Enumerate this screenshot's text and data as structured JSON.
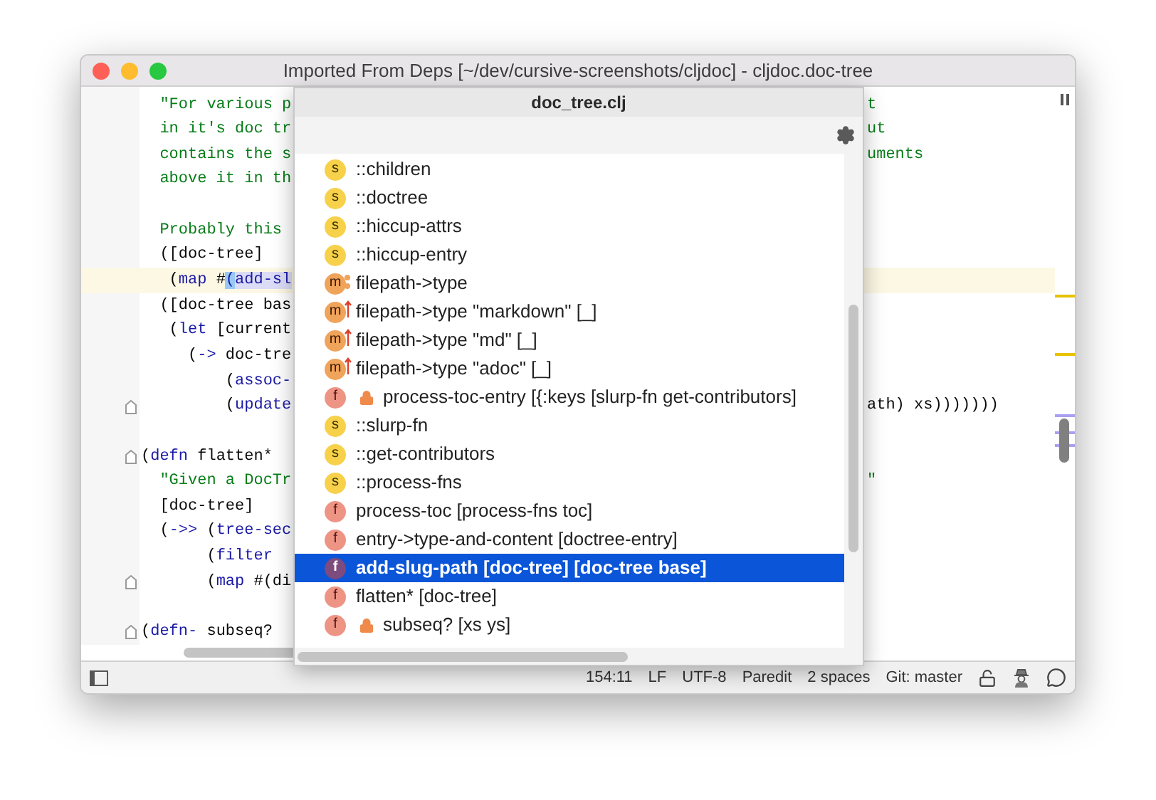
{
  "window": {
    "title": "Imported From Deps [~/dev/cursive-screenshots/cljdoc] - cljdoc.doc-tree"
  },
  "editor": {
    "lines": [
      {
        "segments": [
          {
            "text": "  \"For various p",
            "kind": "string"
          }
        ],
        "right": {
          "text": "t",
          "kind": "string"
        },
        "current": false,
        "fold": false
      },
      {
        "segments": [
          {
            "text": "  in it's doc tr",
            "kind": "string"
          }
        ],
        "right": {
          "text": "ut",
          "kind": "string"
        },
        "current": false,
        "fold": false
      },
      {
        "segments": [
          {
            "text": "  contains the s",
            "kind": "string"
          }
        ],
        "right": {
          "text": "uments",
          "kind": "string"
        },
        "current": false,
        "fold": false
      },
      {
        "segments": [
          {
            "text": "  above it in th",
            "kind": "string"
          }
        ],
        "current": false,
        "fold": false
      },
      {
        "current": false,
        "fold": false
      },
      {
        "segments": [
          {
            "text": "  Probably this",
            "kind": "string"
          }
        ],
        "current": false,
        "fold": false
      },
      {
        "segments": [
          {
            "text": "  ([doc-tree]",
            "kind": "plain"
          }
        ],
        "current": false,
        "fold": false
      },
      {
        "segments": [
          {
            "text": "   (",
            "kind": "plain"
          },
          {
            "text": "map",
            "kind": "keyword"
          },
          {
            "text": " #",
            "kind": "plain"
          },
          {
            "text": "(",
            "kind": "match"
          },
          {
            "text": "add-sl",
            "kind": "usage"
          }
        ],
        "current": true,
        "fold": false
      },
      {
        "segments": [
          {
            "text": "  ([doc-tree bas",
            "kind": "plain"
          }
        ],
        "current": false,
        "fold": false
      },
      {
        "segments": [
          {
            "text": "   (",
            "kind": "plain"
          },
          {
            "text": "let",
            "kind": "keyword"
          },
          {
            "text": " [current",
            "kind": "plain"
          }
        ],
        "current": false,
        "fold": false
      },
      {
        "segments": [
          {
            "text": "     (",
            "kind": "plain"
          },
          {
            "text": "->",
            "kind": "keyword"
          },
          {
            "text": " doc-tre",
            "kind": "plain"
          }
        ],
        "current": false,
        "fold": false
      },
      {
        "segments": [
          {
            "text": "         (",
            "kind": "plain"
          },
          {
            "text": "assoc-",
            "kind": "keyword"
          }
        ],
        "current": false,
        "fold": false
      },
      {
        "segments": [
          {
            "text": "         (",
            "kind": "plain"
          },
          {
            "text": "update",
            "kind": "keyword"
          }
        ],
        "right": {
          "text": "ath) xs)))))))",
          "kind": "plain"
        },
        "current": false,
        "fold": true
      },
      {
        "current": false,
        "fold": false
      },
      {
        "segments": [
          {
            "text": "(",
            "kind": "plain"
          },
          {
            "text": "defn",
            "kind": "keyword"
          },
          {
            "text": " flatten*",
            "kind": "plain"
          }
        ],
        "current": false,
        "fold": true
      },
      {
        "segments": [
          {
            "text": "  \"Given a DocTr",
            "kind": "string"
          }
        ],
        "right": {
          "text": "\"",
          "kind": "string"
        },
        "current": false,
        "fold": false
      },
      {
        "segments": [
          {
            "text": "  [doc-tree]",
            "kind": "plain"
          }
        ],
        "current": false,
        "fold": false
      },
      {
        "segments": [
          {
            "text": "  (",
            "kind": "plain"
          },
          {
            "text": "->>",
            "kind": "keyword"
          },
          {
            "text": " (",
            "kind": "plain"
          },
          {
            "text": "tree-sec",
            "kind": "keyword"
          }
        ],
        "current": false,
        "fold": false
      },
      {
        "segments": [
          {
            "text": "       (",
            "kind": "plain"
          },
          {
            "text": "filter",
            "kind": "keyword"
          }
        ],
        "current": false,
        "fold": false
      },
      {
        "segments": [
          {
            "text": "       (",
            "kind": "plain"
          },
          {
            "text": "map",
            "kind": "keyword"
          },
          {
            "text": " #(di",
            "kind": "plain"
          }
        ],
        "current": false,
        "fold": true
      },
      {
        "current": false,
        "fold": false
      },
      {
        "segments": [
          {
            "text": "(",
            "kind": "plain"
          },
          {
            "text": "defn-",
            "kind": "keyword"
          },
          {
            "text": " subseq?",
            "kind": "plain"
          }
        ],
        "current": false,
        "fold": true
      }
    ]
  },
  "popup": {
    "title": "doc_tree.clj",
    "items": [
      {
        "kind": "keyword",
        "badge": "s",
        "text": "::children",
        "locked": false,
        "selected": false
      },
      {
        "kind": "keyword",
        "badge": "s",
        "text": "::doctree",
        "locked": false,
        "selected": false
      },
      {
        "kind": "keyword",
        "badge": "s",
        "text": "::hiccup-attrs",
        "locked": false,
        "selected": false
      },
      {
        "kind": "keyword",
        "badge": "s",
        "text": "::hiccup-entry",
        "locked": false,
        "selected": false
      },
      {
        "kind": "multimethod",
        "badge": "m",
        "text": "filepath->type",
        "locked": false,
        "selected": false
      },
      {
        "kind": "method",
        "badge": "m",
        "text": "filepath->type \"markdown\" [_]",
        "locked": false,
        "selected": false
      },
      {
        "kind": "method",
        "badge": "m",
        "text": "filepath->type \"md\" [_]",
        "locked": false,
        "selected": false
      },
      {
        "kind": "method",
        "badge": "m",
        "text": "filepath->type \"adoc\" [_]",
        "locked": false,
        "selected": false
      },
      {
        "kind": "function",
        "badge": "f",
        "text": "process-toc-entry [{:keys [slurp-fn get-contributors]",
        "locked": true,
        "selected": false
      },
      {
        "kind": "keyword",
        "badge": "s",
        "text": "::slurp-fn",
        "locked": false,
        "selected": false
      },
      {
        "kind": "keyword",
        "badge": "s",
        "text": "::get-contributors",
        "locked": false,
        "selected": false
      },
      {
        "kind": "keyword",
        "badge": "s",
        "text": "::process-fns",
        "locked": false,
        "selected": false
      },
      {
        "kind": "function",
        "badge": "f",
        "text": "process-toc [process-fns toc]",
        "locked": false,
        "selected": false
      },
      {
        "kind": "function",
        "badge": "f",
        "text": "entry->type-and-content [doctree-entry]",
        "locked": false,
        "selected": false
      },
      {
        "kind": "function",
        "badge": "f",
        "text": "add-slug-path [doc-tree] [doc-tree base]",
        "locked": false,
        "selected": true
      },
      {
        "kind": "function",
        "badge": "f",
        "text": "flatten* [doc-tree]",
        "locked": false,
        "selected": false
      },
      {
        "kind": "function",
        "badge": "f",
        "text": "subseq? [xs ys]",
        "locked": true,
        "selected": false
      }
    ]
  },
  "status_bar": {
    "items": [
      "154:11",
      "LF",
      "UTF-8",
      "Paredit",
      "2 spaces",
      "Git: master"
    ]
  }
}
